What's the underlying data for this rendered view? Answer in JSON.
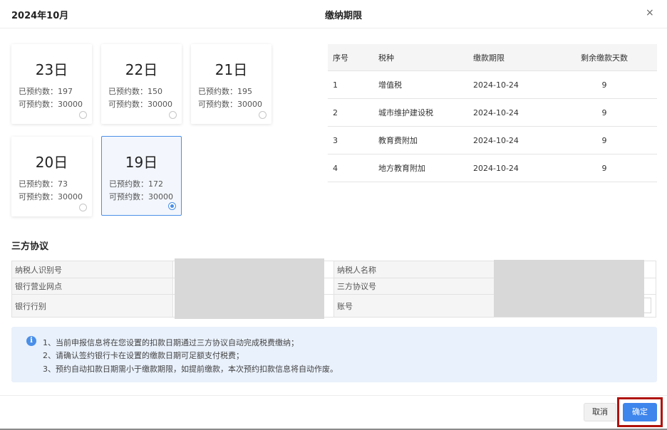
{
  "header": {
    "month": "2024年10月",
    "title": "缴纳期限",
    "close": "×"
  },
  "cards": [
    {
      "day": "23日",
      "booked": "已预约数：197",
      "available": "可预约数：30000",
      "selected": false
    },
    {
      "day": "22日",
      "booked": "已预约数：150",
      "available": "可预约数：30000",
      "selected": false
    },
    {
      "day": "21日",
      "booked": "已预约数：195",
      "available": "可预约数：30000",
      "selected": false
    },
    {
      "day": "20日",
      "booked": "已预约数：73",
      "available": "可预约数：30000",
      "selected": false
    },
    {
      "day": "19日",
      "booked": "已预约数：172",
      "available": "可预约数：30000",
      "selected": true
    }
  ],
  "period_table": {
    "headers": [
      "序号",
      "税种",
      "缴款期限",
      "剩余缴款天数"
    ],
    "rows": [
      [
        "1",
        "增值税",
        "2024-10-24",
        "9"
      ],
      [
        "2",
        "城市维护建设税",
        "2024-10-24",
        "9"
      ],
      [
        "3",
        "教育费附加",
        "2024-10-24",
        "9"
      ],
      [
        "4",
        "地方教育附加",
        "2024-10-24",
        "9"
      ]
    ]
  },
  "agreement": {
    "title": "三方协议",
    "labels": {
      "taxpayer_id": "纳税人识别号",
      "taxpayer_name": "纳税人名称",
      "bank_branch": "银行营业网点",
      "agreement_no": "三方协议号",
      "bank_type": "银行行别",
      "account": "账号"
    }
  },
  "notice": {
    "line1": "1、当前申报信息将在您设置的扣款日期通过三方协议自动完成税费缴纳；",
    "line2": "2、请确认签约银行卡在设置的缴款日期可足额支付税费；",
    "line3": "3、预约自动扣款日期需小于缴款期限，如提前缴款，本次预约扣款信息将自动作废。",
    "icon": "info-icon"
  },
  "footer": {
    "cancel": "取消",
    "confirm": "确定"
  },
  "colors": {
    "primary": "#3e85ec",
    "highlight": "#b0120c",
    "notice_bg": "#e9f1fc"
  }
}
